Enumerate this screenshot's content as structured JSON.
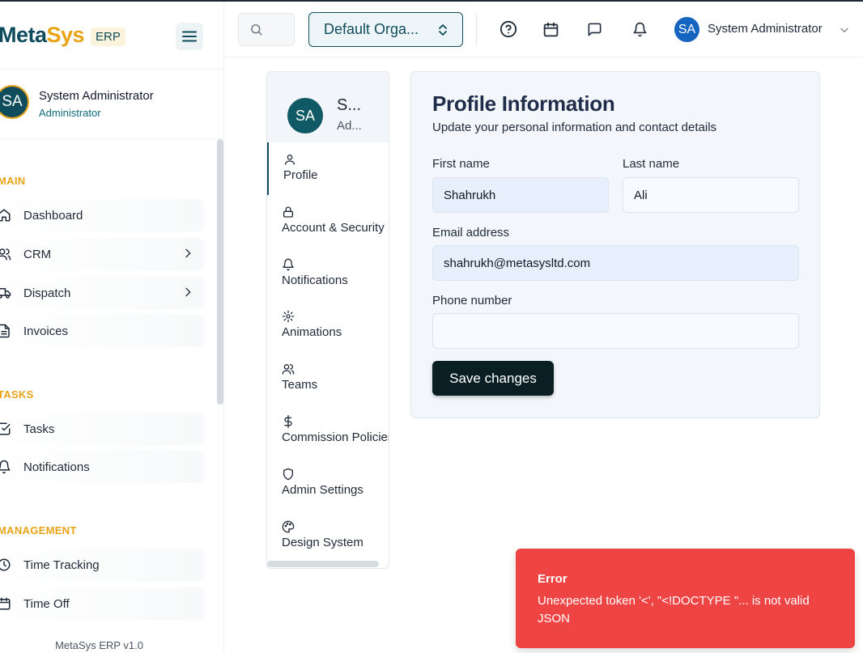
{
  "brand": {
    "name_part1": "Meta",
    "name_part2": "Sys",
    "badge": "ERP"
  },
  "sidebar": {
    "user": {
      "initials": "SA",
      "name": "System Administrator",
      "role": "Administrator"
    },
    "sections": {
      "main": "MAIN",
      "tasks": "TASKS",
      "management": "MANAGEMENT"
    },
    "items": [
      {
        "label": "Dashboard",
        "icon": "home-icon"
      },
      {
        "label": "CRM",
        "icon": "users-icon"
      },
      {
        "label": "Dispatch",
        "icon": "truck-icon"
      },
      {
        "label": "Invoices",
        "icon": "file-text-icon"
      },
      {
        "label": "Tasks",
        "icon": "check-square-icon"
      },
      {
        "label": "Notifications",
        "icon": "bell-icon"
      },
      {
        "label": "Time Tracking",
        "icon": "clock-icon"
      },
      {
        "label": "Time Off",
        "icon": "calendar-icon"
      }
    ],
    "version": "MetaSys ERP v1.0"
  },
  "topbar": {
    "org_select": "Default Orga...",
    "user": {
      "initials": "SA",
      "name": "System Administrator"
    }
  },
  "settings_nav": {
    "user": {
      "initials": "SA",
      "name": "S...",
      "role": "Ad..."
    },
    "items": [
      {
        "label": "Profile",
        "icon": "user-icon",
        "active": true
      },
      {
        "label": "Account & Security",
        "icon": "lock-icon"
      },
      {
        "label": "Notifications",
        "icon": "bell-icon"
      },
      {
        "label": "Animations",
        "icon": "gear-icon"
      },
      {
        "label": "Teams",
        "icon": "users-icon"
      },
      {
        "label": "Commission Policies",
        "icon": "dollar-icon"
      },
      {
        "label": "Admin Settings",
        "icon": "shield-icon"
      },
      {
        "label": "Design System",
        "icon": "palette-icon"
      }
    ]
  },
  "profile": {
    "title": "Profile Information",
    "subtitle": "Update your personal information and contact details",
    "first_name_label": "First name",
    "first_name": "Shahrukh",
    "last_name_label": "Last name",
    "last_name": "Ali",
    "email_label": "Email address",
    "email": "shahrukh@metasysltd.com",
    "phone_label": "Phone number",
    "phone": "",
    "save_label": "Save changes"
  },
  "toast": {
    "title": "Error",
    "message": "Unexpected token '<', \"<!DOCTYPE \"... is not valid JSON"
  },
  "colors": {
    "brand_teal": "#0f4c5c",
    "brand_gold": "#e8a317",
    "error": "#ef4444"
  }
}
